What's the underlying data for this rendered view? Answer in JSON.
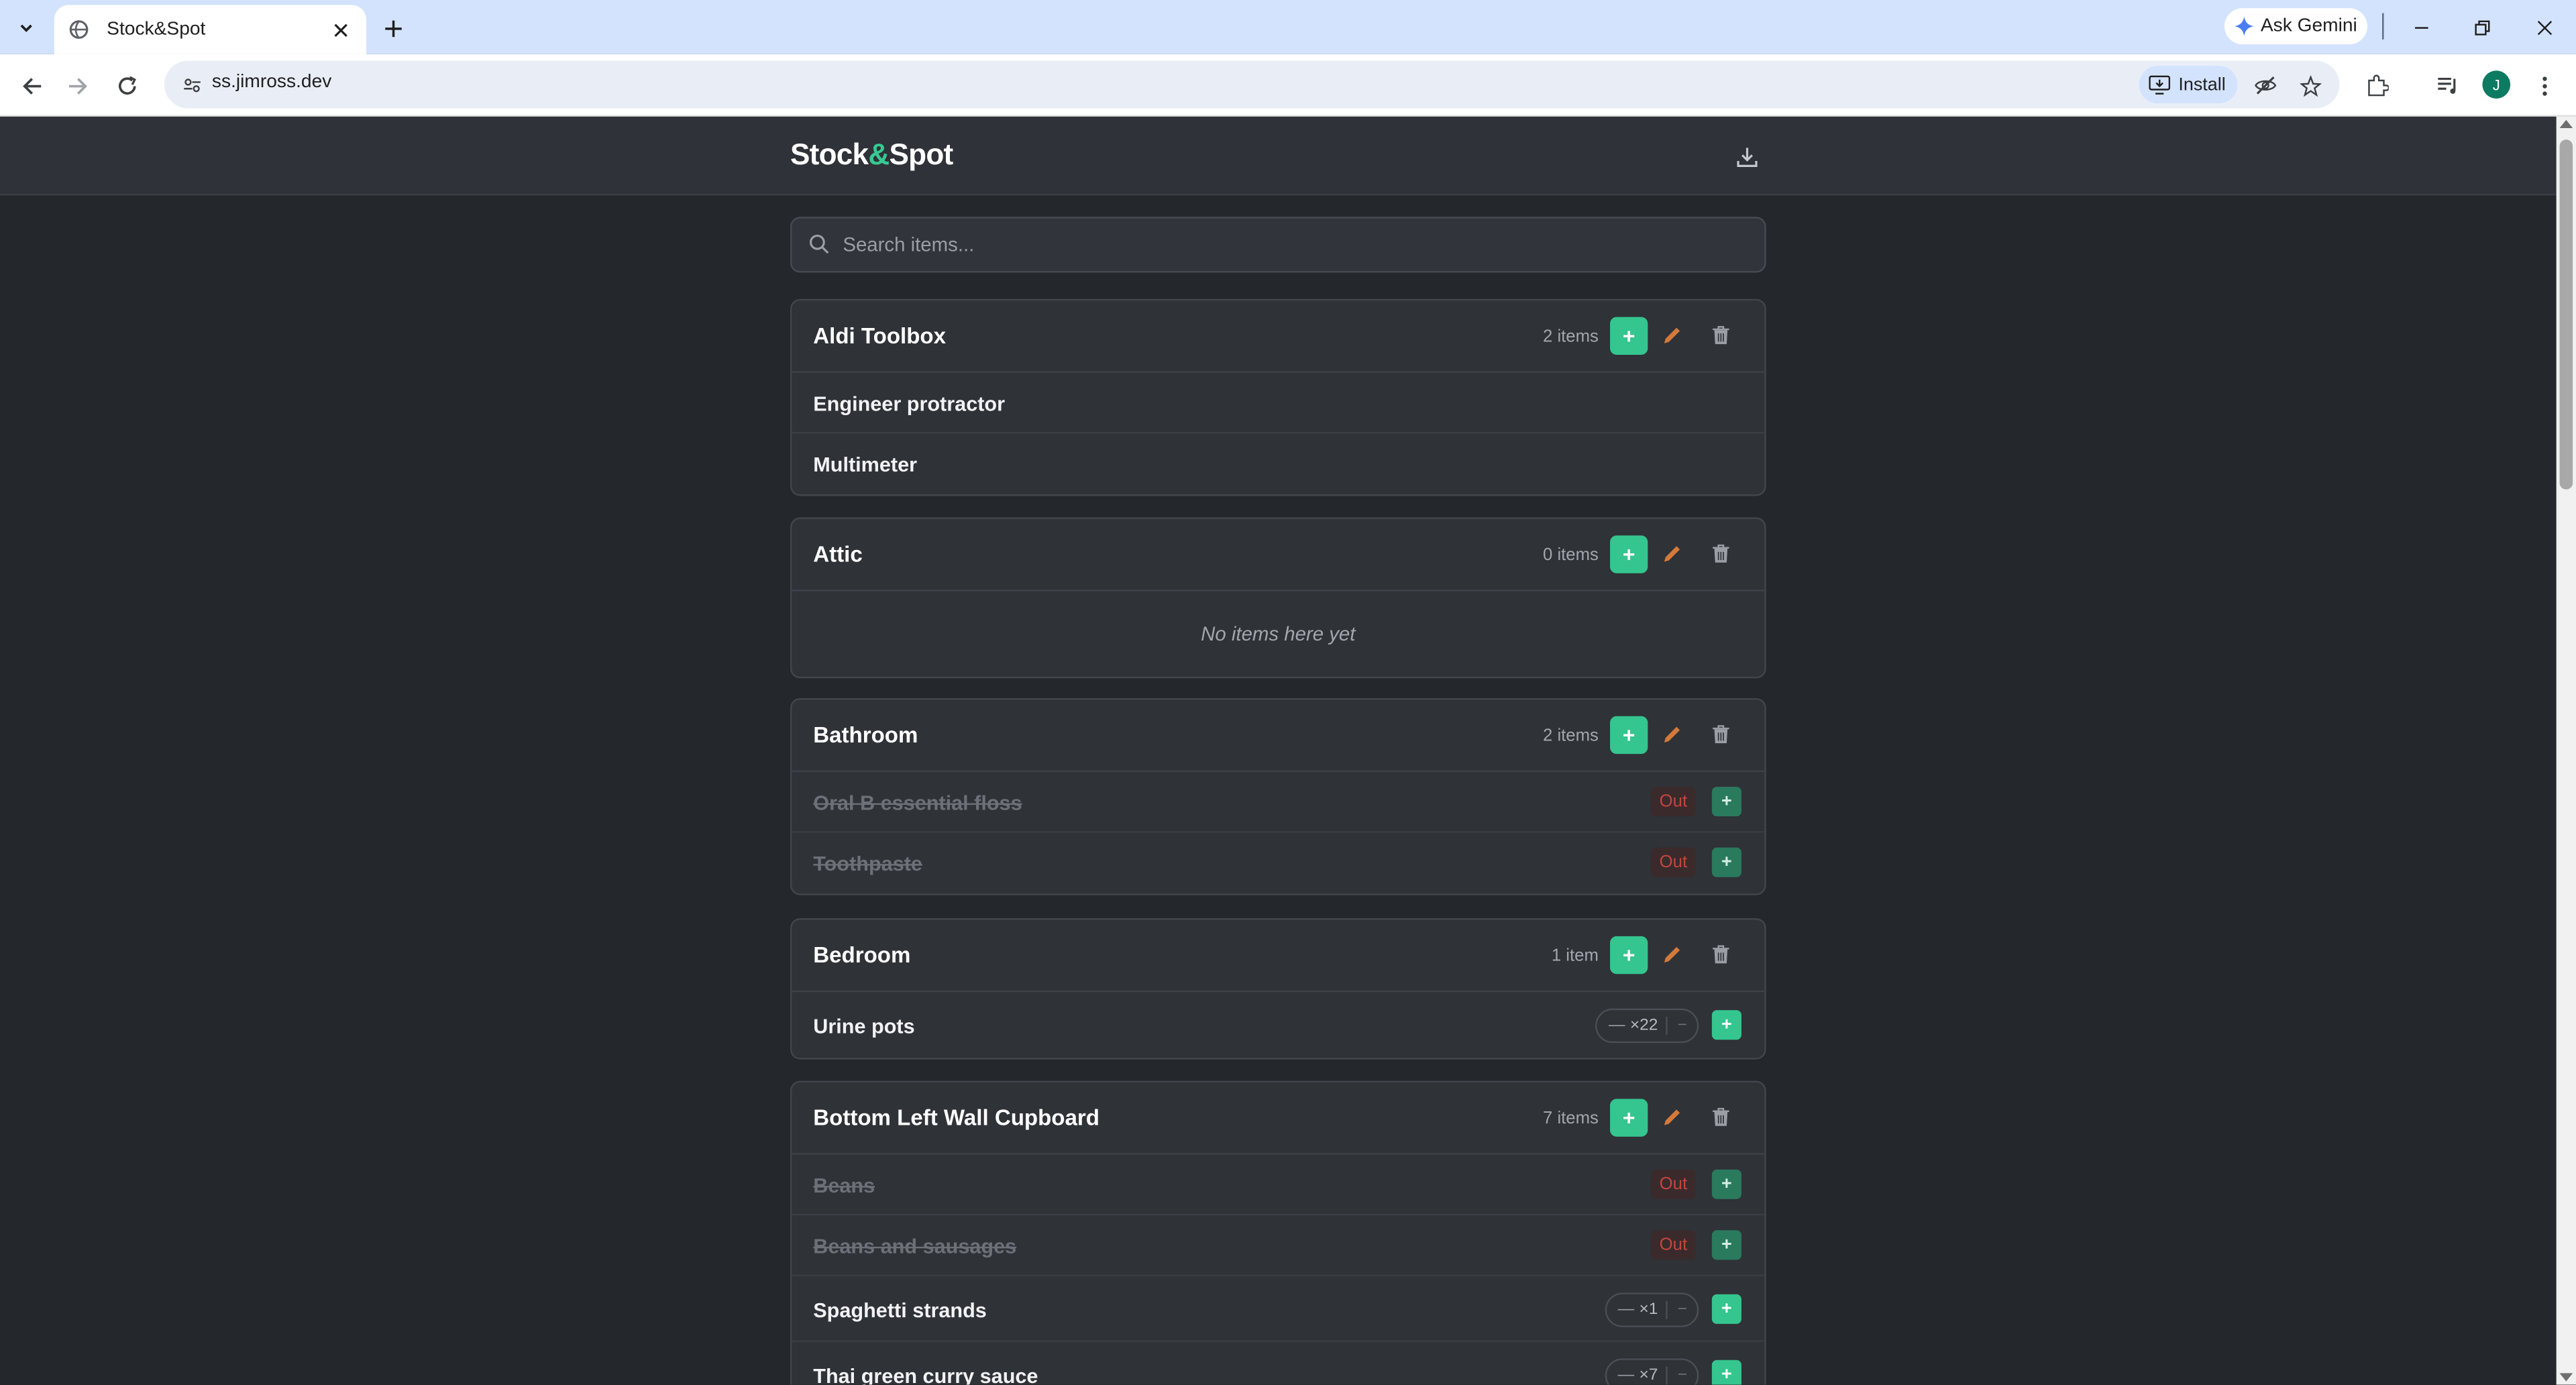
{
  "browser": {
    "tab_title": "Stock&Spot",
    "url": "ss.jimross.dev",
    "ask_gemini": "Ask Gemini",
    "install": "Install",
    "profile_initial": "J"
  },
  "app": {
    "logo_part1": "Stock",
    "logo_amp": "&",
    "logo_part2": "Spot",
    "search_placeholder": "Search items...",
    "accent_color": "#35c58f",
    "out_color": "#c2473e"
  },
  "locations": [
    {
      "name": "Aldi Toolbox",
      "count": "2 items",
      "items": [
        {
          "name": "Engineer protractor"
        },
        {
          "name": "Multimeter"
        }
      ]
    },
    {
      "name": "Attic",
      "count": "0 items",
      "empty_text": "No items here yet"
    },
    {
      "name": "Bathroom",
      "count": "2 items",
      "items": [
        {
          "name": "Oral B essential floss",
          "status": "Out",
          "add": "+"
        },
        {
          "name": "Toothpaste",
          "status": "Out",
          "add": "+"
        }
      ]
    },
    {
      "name": "Bedroom",
      "count": "1 item",
      "items": [
        {
          "name": "Urine pots",
          "qty_minus": "—",
          "qty": "×22",
          "dec": "−",
          "add": "+"
        }
      ]
    },
    {
      "name": "Bottom Left Wall Cupboard",
      "count": "7 items",
      "items": [
        {
          "name": "Beans",
          "status": "Out",
          "add": "+"
        },
        {
          "name": "Beans and sausages",
          "status": "Out",
          "add": "+"
        },
        {
          "name": "Spaghetti strands",
          "qty_minus": "—",
          "qty": "×1",
          "dec": "−",
          "add": "+"
        },
        {
          "name": "Thai green curry sauce",
          "qty_minus": "—",
          "qty": "×7",
          "dec": "−",
          "add": "+"
        }
      ]
    }
  ],
  "buttons": {
    "add": "+"
  }
}
